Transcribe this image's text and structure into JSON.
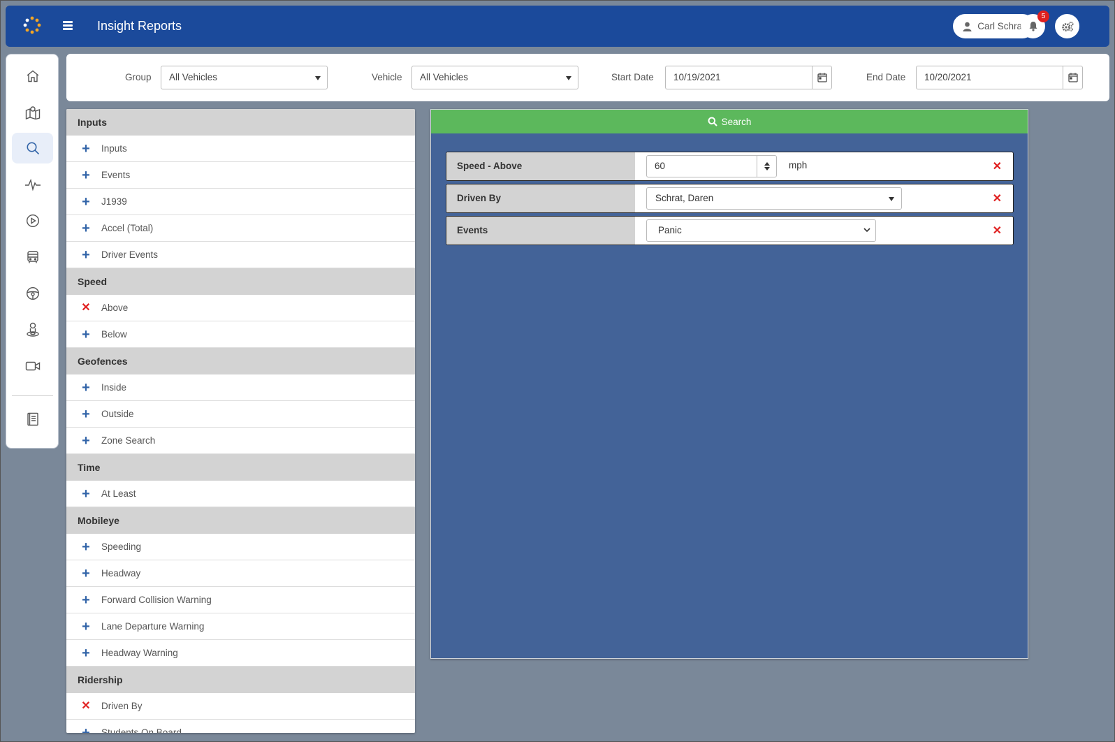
{
  "app": {
    "title": "Insight Reports"
  },
  "header": {
    "user_name": "Carl Schrat",
    "notification_count": "5"
  },
  "nav": {
    "items": [
      "home-icon",
      "map-icon",
      "search-icon",
      "pulse-icon",
      "play-icon",
      "bus-icon",
      "steering-wheel-icon",
      "driver-icon",
      "video-camera-icon",
      "report-book-icon"
    ],
    "active": "search-icon"
  },
  "filters": {
    "group_label": "Group",
    "group_value": "All Vehicles",
    "vehicle_label": "Vehicle",
    "vehicle_value": "All Vehicles",
    "start_label": "Start Date",
    "start_value": "10/19/2021",
    "end_label": "End Date",
    "end_value": "10/20/2021"
  },
  "criteria_sections": [
    {
      "title": "Inputs",
      "items": [
        {
          "label": "Inputs",
          "selected": false
        },
        {
          "label": "Events",
          "selected": false
        },
        {
          "label": "J1939",
          "selected": false
        },
        {
          "label": "Accel (Total)",
          "selected": false
        },
        {
          "label": "Driver Events",
          "selected": false
        }
      ]
    },
    {
      "title": "Speed",
      "items": [
        {
          "label": "Above",
          "selected": true
        },
        {
          "label": "Below",
          "selected": false
        }
      ]
    },
    {
      "title": "Geofences",
      "items": [
        {
          "label": "Inside",
          "selected": false
        },
        {
          "label": "Outside",
          "selected": false
        },
        {
          "label": "Zone Search",
          "selected": false
        }
      ]
    },
    {
      "title": "Time",
      "items": [
        {
          "label": "At Least",
          "selected": false
        }
      ]
    },
    {
      "title": "Mobileye",
      "items": [
        {
          "label": "Speeding",
          "selected": false
        },
        {
          "label": "Headway",
          "selected": false
        },
        {
          "label": "Forward Collision Warning",
          "selected": false
        },
        {
          "label": "Lane Departure Warning",
          "selected": false
        },
        {
          "label": "Headway Warning",
          "selected": false
        }
      ]
    },
    {
      "title": "Ridership",
      "items": [
        {
          "label": "Driven By",
          "selected": true
        },
        {
          "label": "Students On Board",
          "selected": false
        }
      ]
    }
  ],
  "search": {
    "label": "Search"
  },
  "active_criteria": {
    "speed": {
      "name": "Speed - Above",
      "value": "60",
      "unit": "mph"
    },
    "driven_by": {
      "name": "Driven By",
      "value": "Schrat, Daren"
    },
    "events": {
      "name": "Events",
      "value": "Panic"
    }
  },
  "colors": {
    "header_bg": "#1b4a9b",
    "page_bg": "#7a8899",
    "panel_bg": "#436398",
    "search_green": "#5cb85c",
    "remove_red": "#e02020",
    "add_blue": "#3264a8"
  }
}
